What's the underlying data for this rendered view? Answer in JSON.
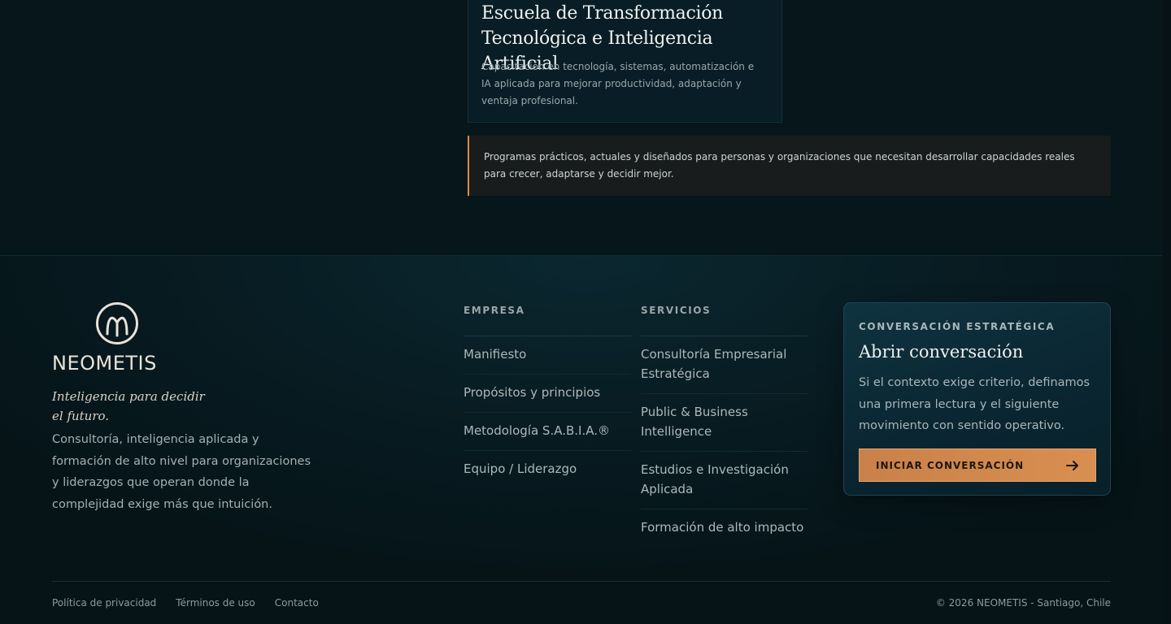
{
  "school_card": {
    "title": "Escuela de Transformación Tecnológica e Inteligencia Artificial",
    "description": "Capacitación en tecnología, sistemas, automatización e IA aplicada para mejorar productividad, adaptación y ventaja profesional."
  },
  "callout": {
    "text": "Programas prácticos, actuales y diseñados para personas y organizaciones que necesitan desarrollar capacidades reales para crecer, adaptarse y decidir mejor."
  },
  "footer": {
    "brand": {
      "name": "NEOMETIS",
      "tagline": "Inteligencia para decidir el futuro.",
      "about": "Consultoría, inteligencia aplicada y formación de alto nivel para organizaciones y liderazgos que operan donde la complejidad exige más que intuición."
    },
    "empresa": {
      "heading": "EMPRESA",
      "items": [
        {
          "label": "Manifiesto"
        },
        {
          "label": "Propósitos y principios"
        },
        {
          "label": "Metodología S.A.B.I.A.®"
        },
        {
          "label": "Equipo / Liderazgo"
        }
      ]
    },
    "servicios": {
      "heading": "SERVICIOS",
      "items": [
        {
          "label": "Consultoría Empresarial Estratégica"
        },
        {
          "label": "Public & Business Intelligence"
        },
        {
          "label": "Estudios e Investigación Aplicada"
        },
        {
          "label": "Formación de alto impacto"
        }
      ]
    },
    "cta": {
      "kicker": "CONVERSACIÓN ESTRATÉGICA",
      "title": "Abrir conversación",
      "description": "Si el contexto exige criterio, definamos una primera lectura y el siguiente movimiento con sentido operativo.",
      "button_label": "INICIAR CONVERSACIÓN",
      "button_icon": "arrow-right-icon"
    },
    "legal": [
      {
        "label": "Política de privacidad"
      },
      {
        "label": "Términos de uso"
      },
      {
        "label": "Contacto"
      }
    ],
    "copyright": "© 2026 NEOMETIS - Santiago, Chile"
  },
  "colors": {
    "accent": "#d98d4a",
    "background": "#07151a",
    "logo": "#e8e2d8"
  }
}
